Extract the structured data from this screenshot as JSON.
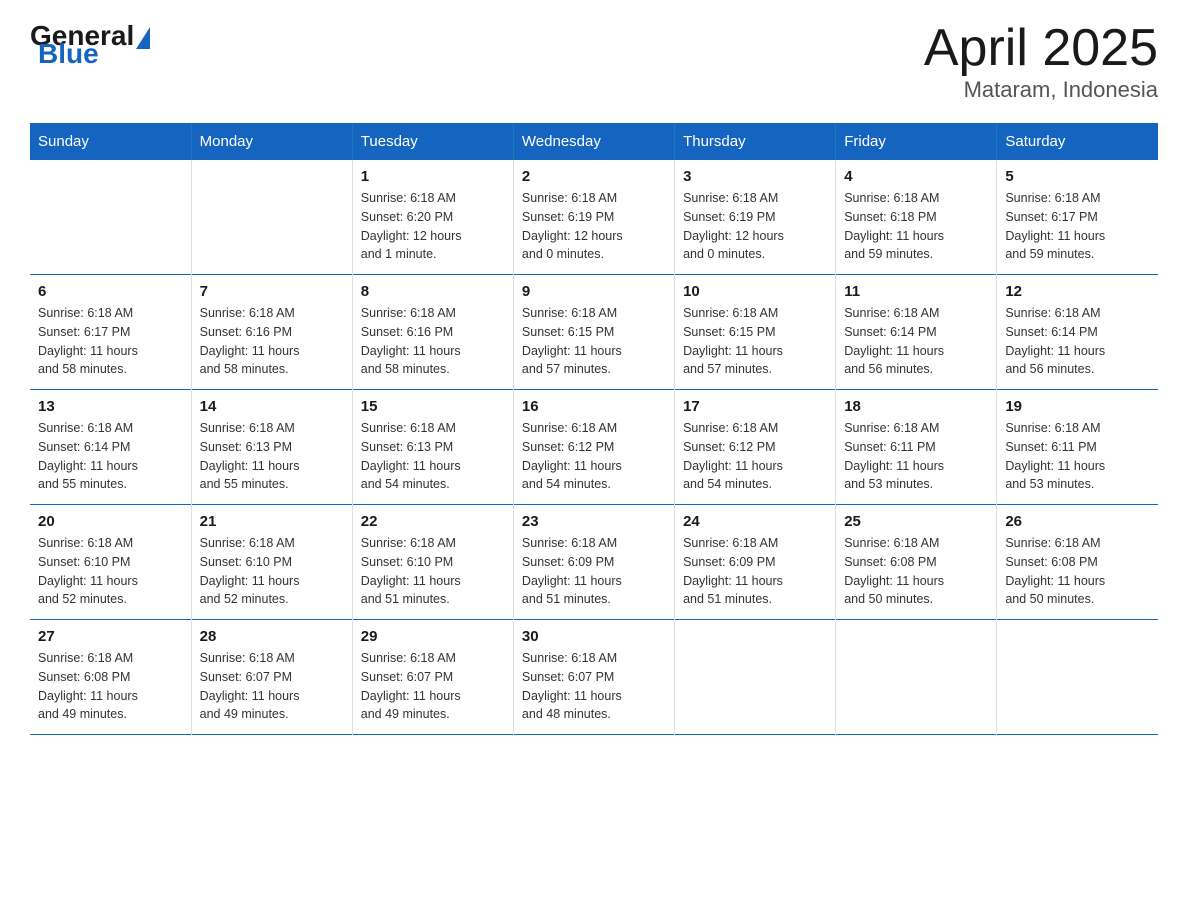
{
  "logo": {
    "general": "General",
    "blue": "Blue"
  },
  "title": "April 2025",
  "subtitle": "Mataram, Indonesia",
  "days_header": [
    "Sunday",
    "Monday",
    "Tuesday",
    "Wednesday",
    "Thursday",
    "Friday",
    "Saturday"
  ],
  "weeks": [
    [
      {
        "day": "",
        "info": ""
      },
      {
        "day": "",
        "info": ""
      },
      {
        "day": "1",
        "info": "Sunrise: 6:18 AM\nSunset: 6:20 PM\nDaylight: 12 hours\nand 1 minute."
      },
      {
        "day": "2",
        "info": "Sunrise: 6:18 AM\nSunset: 6:19 PM\nDaylight: 12 hours\nand 0 minutes."
      },
      {
        "day": "3",
        "info": "Sunrise: 6:18 AM\nSunset: 6:19 PM\nDaylight: 12 hours\nand 0 minutes."
      },
      {
        "day": "4",
        "info": "Sunrise: 6:18 AM\nSunset: 6:18 PM\nDaylight: 11 hours\nand 59 minutes."
      },
      {
        "day": "5",
        "info": "Sunrise: 6:18 AM\nSunset: 6:17 PM\nDaylight: 11 hours\nand 59 minutes."
      }
    ],
    [
      {
        "day": "6",
        "info": "Sunrise: 6:18 AM\nSunset: 6:17 PM\nDaylight: 11 hours\nand 58 minutes."
      },
      {
        "day": "7",
        "info": "Sunrise: 6:18 AM\nSunset: 6:16 PM\nDaylight: 11 hours\nand 58 minutes."
      },
      {
        "day": "8",
        "info": "Sunrise: 6:18 AM\nSunset: 6:16 PM\nDaylight: 11 hours\nand 58 minutes."
      },
      {
        "day": "9",
        "info": "Sunrise: 6:18 AM\nSunset: 6:15 PM\nDaylight: 11 hours\nand 57 minutes."
      },
      {
        "day": "10",
        "info": "Sunrise: 6:18 AM\nSunset: 6:15 PM\nDaylight: 11 hours\nand 57 minutes."
      },
      {
        "day": "11",
        "info": "Sunrise: 6:18 AM\nSunset: 6:14 PM\nDaylight: 11 hours\nand 56 minutes."
      },
      {
        "day": "12",
        "info": "Sunrise: 6:18 AM\nSunset: 6:14 PM\nDaylight: 11 hours\nand 56 minutes."
      }
    ],
    [
      {
        "day": "13",
        "info": "Sunrise: 6:18 AM\nSunset: 6:14 PM\nDaylight: 11 hours\nand 55 minutes."
      },
      {
        "day": "14",
        "info": "Sunrise: 6:18 AM\nSunset: 6:13 PM\nDaylight: 11 hours\nand 55 minutes."
      },
      {
        "day": "15",
        "info": "Sunrise: 6:18 AM\nSunset: 6:13 PM\nDaylight: 11 hours\nand 54 minutes."
      },
      {
        "day": "16",
        "info": "Sunrise: 6:18 AM\nSunset: 6:12 PM\nDaylight: 11 hours\nand 54 minutes."
      },
      {
        "day": "17",
        "info": "Sunrise: 6:18 AM\nSunset: 6:12 PM\nDaylight: 11 hours\nand 54 minutes."
      },
      {
        "day": "18",
        "info": "Sunrise: 6:18 AM\nSunset: 6:11 PM\nDaylight: 11 hours\nand 53 minutes."
      },
      {
        "day": "19",
        "info": "Sunrise: 6:18 AM\nSunset: 6:11 PM\nDaylight: 11 hours\nand 53 minutes."
      }
    ],
    [
      {
        "day": "20",
        "info": "Sunrise: 6:18 AM\nSunset: 6:10 PM\nDaylight: 11 hours\nand 52 minutes."
      },
      {
        "day": "21",
        "info": "Sunrise: 6:18 AM\nSunset: 6:10 PM\nDaylight: 11 hours\nand 52 minutes."
      },
      {
        "day": "22",
        "info": "Sunrise: 6:18 AM\nSunset: 6:10 PM\nDaylight: 11 hours\nand 51 minutes."
      },
      {
        "day": "23",
        "info": "Sunrise: 6:18 AM\nSunset: 6:09 PM\nDaylight: 11 hours\nand 51 minutes."
      },
      {
        "day": "24",
        "info": "Sunrise: 6:18 AM\nSunset: 6:09 PM\nDaylight: 11 hours\nand 51 minutes."
      },
      {
        "day": "25",
        "info": "Sunrise: 6:18 AM\nSunset: 6:08 PM\nDaylight: 11 hours\nand 50 minutes."
      },
      {
        "day": "26",
        "info": "Sunrise: 6:18 AM\nSunset: 6:08 PM\nDaylight: 11 hours\nand 50 minutes."
      }
    ],
    [
      {
        "day": "27",
        "info": "Sunrise: 6:18 AM\nSunset: 6:08 PM\nDaylight: 11 hours\nand 49 minutes."
      },
      {
        "day": "28",
        "info": "Sunrise: 6:18 AM\nSunset: 6:07 PM\nDaylight: 11 hours\nand 49 minutes."
      },
      {
        "day": "29",
        "info": "Sunrise: 6:18 AM\nSunset: 6:07 PM\nDaylight: 11 hours\nand 49 minutes."
      },
      {
        "day": "30",
        "info": "Sunrise: 6:18 AM\nSunset: 6:07 PM\nDaylight: 11 hours\nand 48 minutes."
      },
      {
        "day": "",
        "info": ""
      },
      {
        "day": "",
        "info": ""
      },
      {
        "day": "",
        "info": ""
      }
    ]
  ]
}
